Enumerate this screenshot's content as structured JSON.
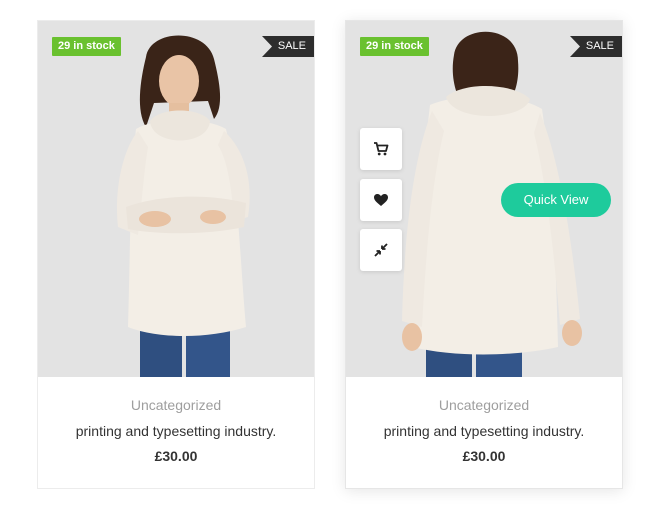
{
  "products": [
    {
      "stock_badge": "29 in stock",
      "sale_label": "SALE",
      "category": "Uncategorized",
      "title": "printing and typesetting industry.",
      "price": "£30.00"
    },
    {
      "stock_badge": "29 in stock",
      "sale_label": "SALE",
      "category": "Uncategorized",
      "title": "printing and typesetting industry.",
      "price": "£30.00",
      "quick_view_label": "Quick View",
      "actions": [
        "cart-icon",
        "heart-icon",
        "compare-icon"
      ]
    }
  ],
  "colors": {
    "stock_badge": "#6ac12f",
    "sale_ribbon": "#2d2d2d",
    "quick_view": "#1ecb9c",
    "photo_background": "#e3e3e3"
  }
}
